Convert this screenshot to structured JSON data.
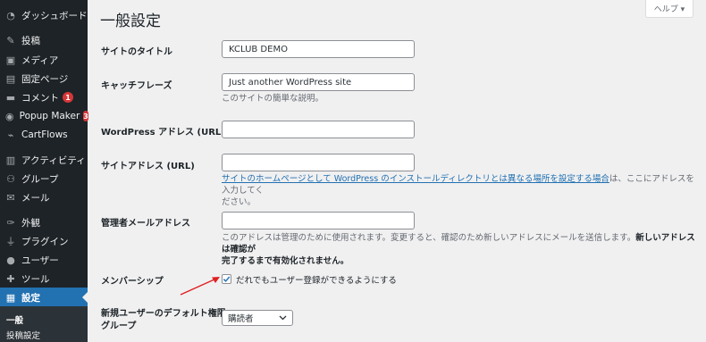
{
  "sidebar": {
    "items": [
      {
        "label": "ダッシュボード",
        "icon": "dashboard-icon"
      },
      {
        "label": "投稿",
        "icon": "pin-icon"
      },
      {
        "label": "メディア",
        "icon": "media-icon"
      },
      {
        "label": "固定ページ",
        "icon": "page-icon"
      },
      {
        "label": "コメント",
        "icon": "comment-icon",
        "badge": "1"
      },
      {
        "label": "Popup Maker",
        "icon": "popup-maker-icon",
        "badge": "3"
      },
      {
        "label": "CartFlows",
        "icon": "cartflows-icon"
      },
      {
        "label": "アクティビティ",
        "icon": "activity-icon"
      },
      {
        "label": "グループ",
        "icon": "groups-icon"
      },
      {
        "label": "メール",
        "icon": "mail-icon"
      },
      {
        "label": "外観",
        "icon": "appearance-icon"
      },
      {
        "label": "プラグイン",
        "icon": "plugin-icon"
      },
      {
        "label": "ユーザー",
        "icon": "user-icon"
      },
      {
        "label": "ツール",
        "icon": "tools-icon"
      },
      {
        "label": "設定",
        "icon": "settings-icon"
      }
    ],
    "submenu": [
      "一般",
      "投稿設定"
    ]
  },
  "main": {
    "title": "一般設定",
    "help_label": "ヘルプ ▾",
    "fields": {
      "site_title_label": "サイトのタイトル",
      "site_title_value": "KCLUB DEMO",
      "tagline_label": "キャッチフレーズ",
      "tagline_value": "Just another WordPress site",
      "tagline_desc": "このサイトの簡単な説明。",
      "wp_address_label": "WordPress アドレス (URL)",
      "wp_address_value": "",
      "site_address_label": "サイトアドレス (URL)",
      "site_address_value": "",
      "site_address_link": "サイトのホームページとして WordPress のインストールディレクトリとは異なる場所を設定する場合",
      "site_address_desc_rest_1": "は、ここにアドレスを入力してく",
      "site_address_desc_rest_2": "ださい。",
      "admin_email_label": "管理者メールアドレス",
      "admin_email_value": "",
      "admin_email_desc_1": "このアドレスは管理のために使用されます。変更すると、確認のため新しいアドレスにメールを送信します。",
      "admin_email_desc_bold_1": "新しいアドレスは確認が",
      "admin_email_desc_bold_2": "完了するまで有効化されません。",
      "membership_label": "メンバーシップ",
      "membership_checkbox_label": "だれでもユーザー登録ができるようにする",
      "membership_checked": true,
      "default_role_label_1": "新規ユーザーのデフォルト権限",
      "default_role_label_2": "グループ",
      "default_role_value": "購読者"
    }
  },
  "colors": {
    "sidebar_bg": "#1d2327",
    "active_menu": "#2271b1",
    "badge": "#d63638",
    "annotation_arrow": "#e02020"
  }
}
